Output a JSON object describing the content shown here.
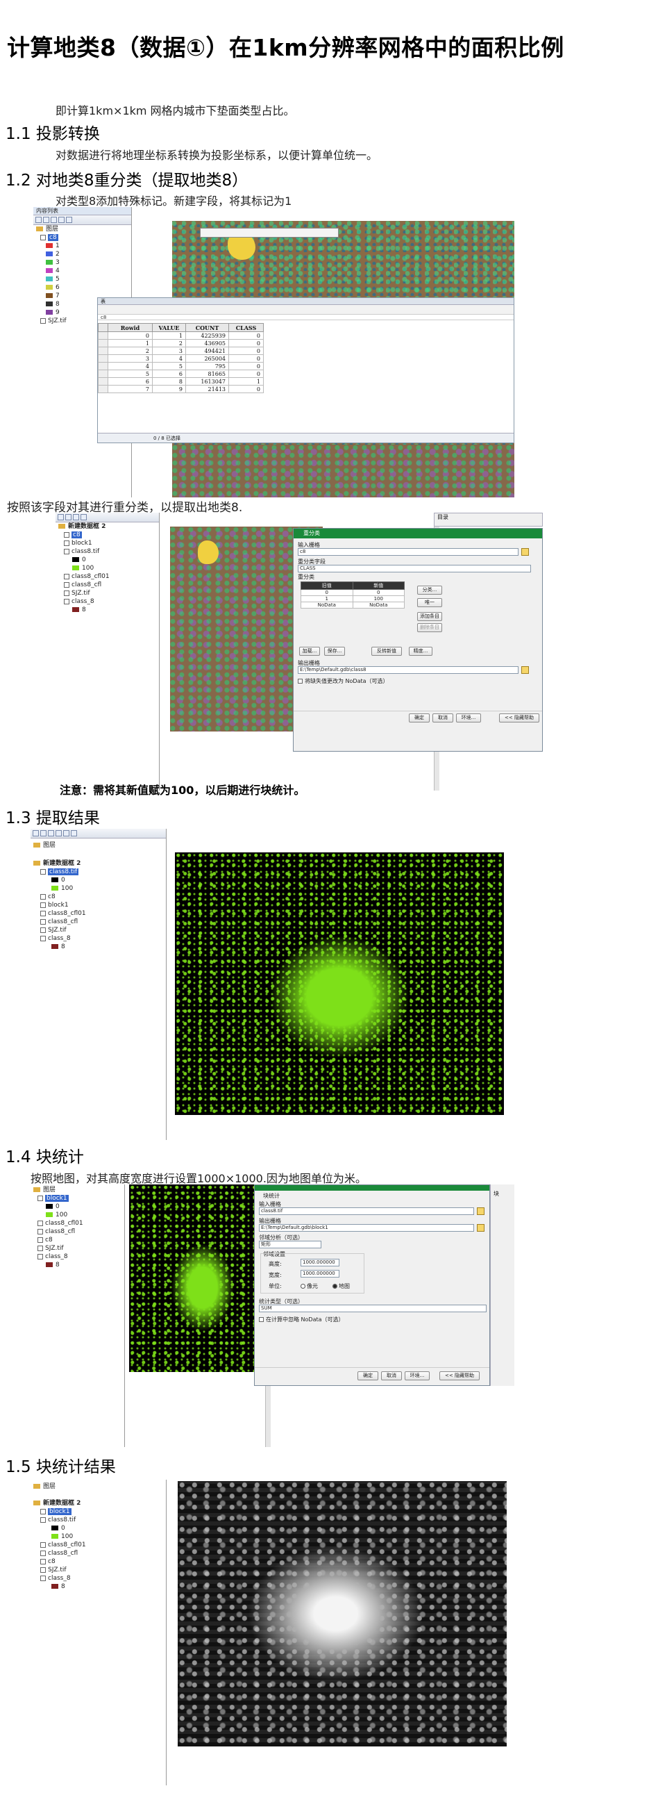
{
  "title": "计算地类8（数据①）在1km分辨率网格中的面积比例",
  "intro": "即计算1km×1km 网格内城市下垫面类型占比。",
  "sections": [
    {
      "heading": "1.1 投影转换",
      "text": "对数据进行将地理坐标系转换为投影坐标系，以便计算单位统一。"
    },
    {
      "heading": "1.2 对地类8重分类（提取地类8）",
      "text": "对类型8添加特殊标记。新建字段，将其标记为1"
    },
    {
      "heading": "1.3 提取结果"
    },
    {
      "heading": "1.4 块统计",
      "text": "按照地图，对其高度宽度进行设置1000×1000.因为地图单位为米。"
    },
    {
      "heading": "1.5 块统计结果"
    }
  ],
  "reclass_text": "按照该字段对其进行重分类，以提取出地类8.",
  "note": "注意：需将其新值赋为100，以后期进行块统计。",
  "shot1": {
    "toc_header": "内容列表",
    "toc_items": [
      "图层",
      "c8",
      "1",
      "2",
      "3",
      "4",
      "5",
      "6",
      "7",
      "8",
      "9",
      "SJZ.tif"
    ],
    "table_title": "表",
    "columns": [
      "Rowid",
      "VALUE",
      "COUNT",
      "CLASS"
    ],
    "rows": [
      [
        "0",
        "1",
        "4225939",
        "0"
      ],
      [
        "1",
        "2",
        "436905",
        "0"
      ],
      [
        "2",
        "3",
        "494421",
        "0"
      ],
      [
        "3",
        "4",
        "265004",
        "0"
      ],
      [
        "4",
        "5",
        "795",
        "0"
      ],
      [
        "5",
        "6",
        "81665",
        "0"
      ],
      [
        "6",
        "8",
        "1613047",
        "1"
      ],
      [
        "7",
        "9",
        "21413",
        "0"
      ]
    ],
    "footer": "0 / 8 已选择",
    "footer_tab": "c8"
  },
  "shot2": {
    "toc_items": [
      "新建数据框 2",
      "c8",
      "block1",
      "class8.tif",
      "0",
      "100",
      "class8_cfl01",
      "class8_cfl",
      "SJZ.tif",
      "class_8",
      "8"
    ],
    "dialog_title": "重分类",
    "input_label": "输入栅格",
    "input_value": "c8",
    "field_label": "重分类字段",
    "field_value": "CLASS",
    "reclass_label": "重分类",
    "grid_head": [
      "旧值",
      "新值"
    ],
    "grid_rows": [
      [
        "0",
        "0"
      ],
      [
        "1",
        "100"
      ],
      [
        "NoData",
        "NoData"
      ]
    ],
    "side_buttons": [
      "分类...",
      "唯一",
      "添加条目",
      "删除条目"
    ],
    "bottom_buttons": [
      "加载...",
      "保存...",
      "反转新值",
      "精度..."
    ],
    "output_label": "输出栅格",
    "output_value": "E:\\Temp\\Default.gdb\\class8",
    "nodata_check": "将缺失值更改为 NoData（可选）",
    "dialog_buttons": [
      "确定",
      "取消",
      "环境...",
      "<< 隐藏帮助"
    ],
    "right_panel": "目录"
  },
  "shot3": {
    "toc_items": [
      "图层",
      "新建数据框 2",
      "class8.tif",
      "0",
      "100",
      "c8",
      "block1",
      "class8_cfl01",
      "class8_cfl",
      "SJZ.tif",
      "class_8",
      "8"
    ]
  },
  "shot4": {
    "toc_items": [
      "图层",
      "block1",
      "0",
      "100",
      "class8_cfl01",
      "class8_cfl",
      "c8",
      "SJZ.tif",
      "class_8",
      "8"
    ],
    "dialog_title": "块统计",
    "input_label": "输入栅格",
    "input_value": "class8.tif",
    "output_label": "输出栅格",
    "output_value": "E:\\Temp\\Default.gdb\\block1",
    "neigh_label": "邻域分析（可选）",
    "neigh_value": "矩形",
    "settings_label": "邻域设置",
    "height_label": "高度:",
    "height_value": "1000.000000",
    "width_label": "宽度:",
    "width_value": "1000.000000",
    "unit_label": "单位:",
    "unit_cell": "像元",
    "unit_map": "地图",
    "stat_label": "统计类型（可选）",
    "stat_value": "SUM",
    "nodata_check": "在计算中忽略 NoData（可选）",
    "dialog_buttons": [
      "确定",
      "取消",
      "环境...",
      "<< 隐藏帮助"
    ],
    "right_panel": "块"
  },
  "shot5": {
    "toc_items": [
      "图层",
      "新建数据框 2",
      "block1",
      "class8.tif",
      "0",
      "100",
      "class8_cfl01",
      "class8_cfl",
      "c8",
      "SJZ.tif",
      "class_8",
      "8"
    ]
  }
}
